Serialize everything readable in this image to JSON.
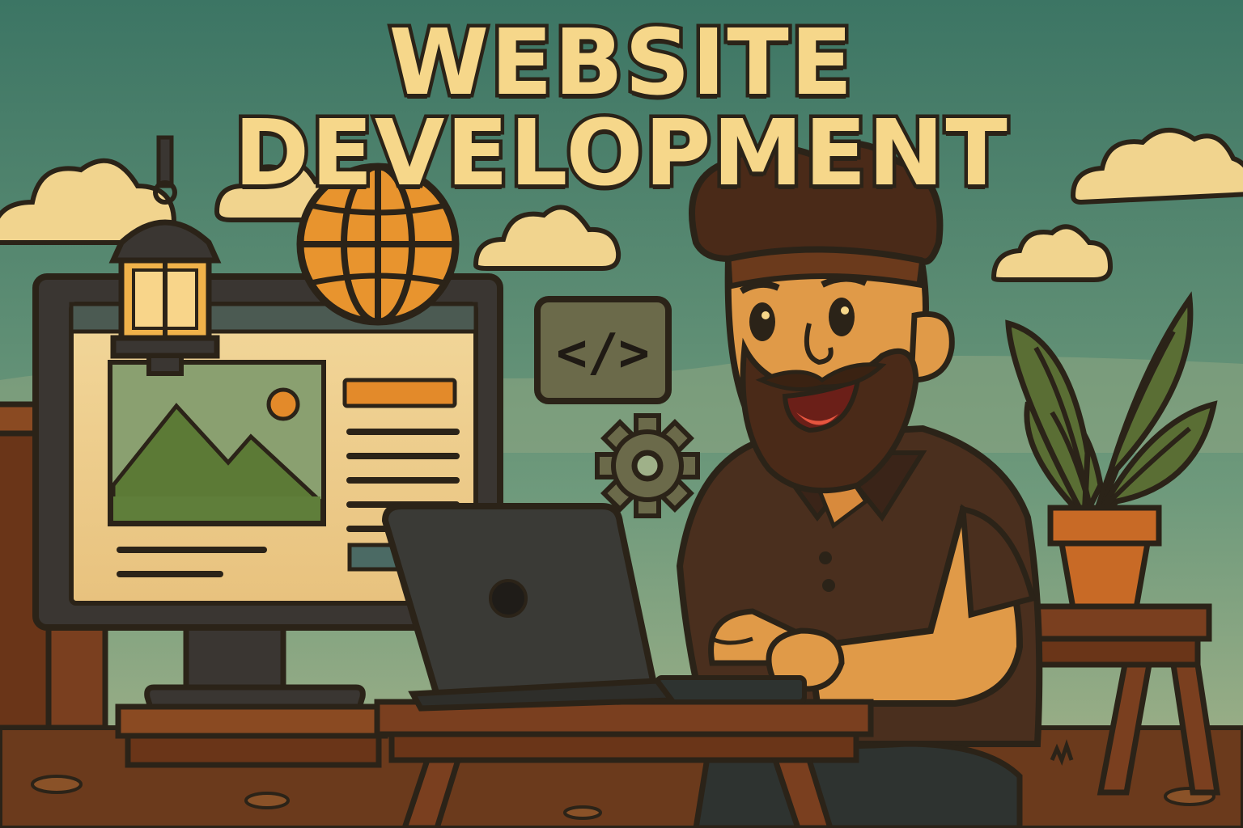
{
  "title": "WEBSITE DEVELOPMENT",
  "code_badge": "</>",
  "colors": {
    "sky_top": "#3f7a6a",
    "sky_bottom": "#9fb189",
    "title_fill": "#f6d78a",
    "outline": "#2b2318",
    "wood": "#7a3f1f",
    "ground": "#6b3a1c",
    "accent_orange": "#e38a2a"
  },
  "icons": [
    "lantern-icon",
    "globe-icon",
    "code-icon",
    "gear-icon",
    "laptop-logo-icon"
  ]
}
